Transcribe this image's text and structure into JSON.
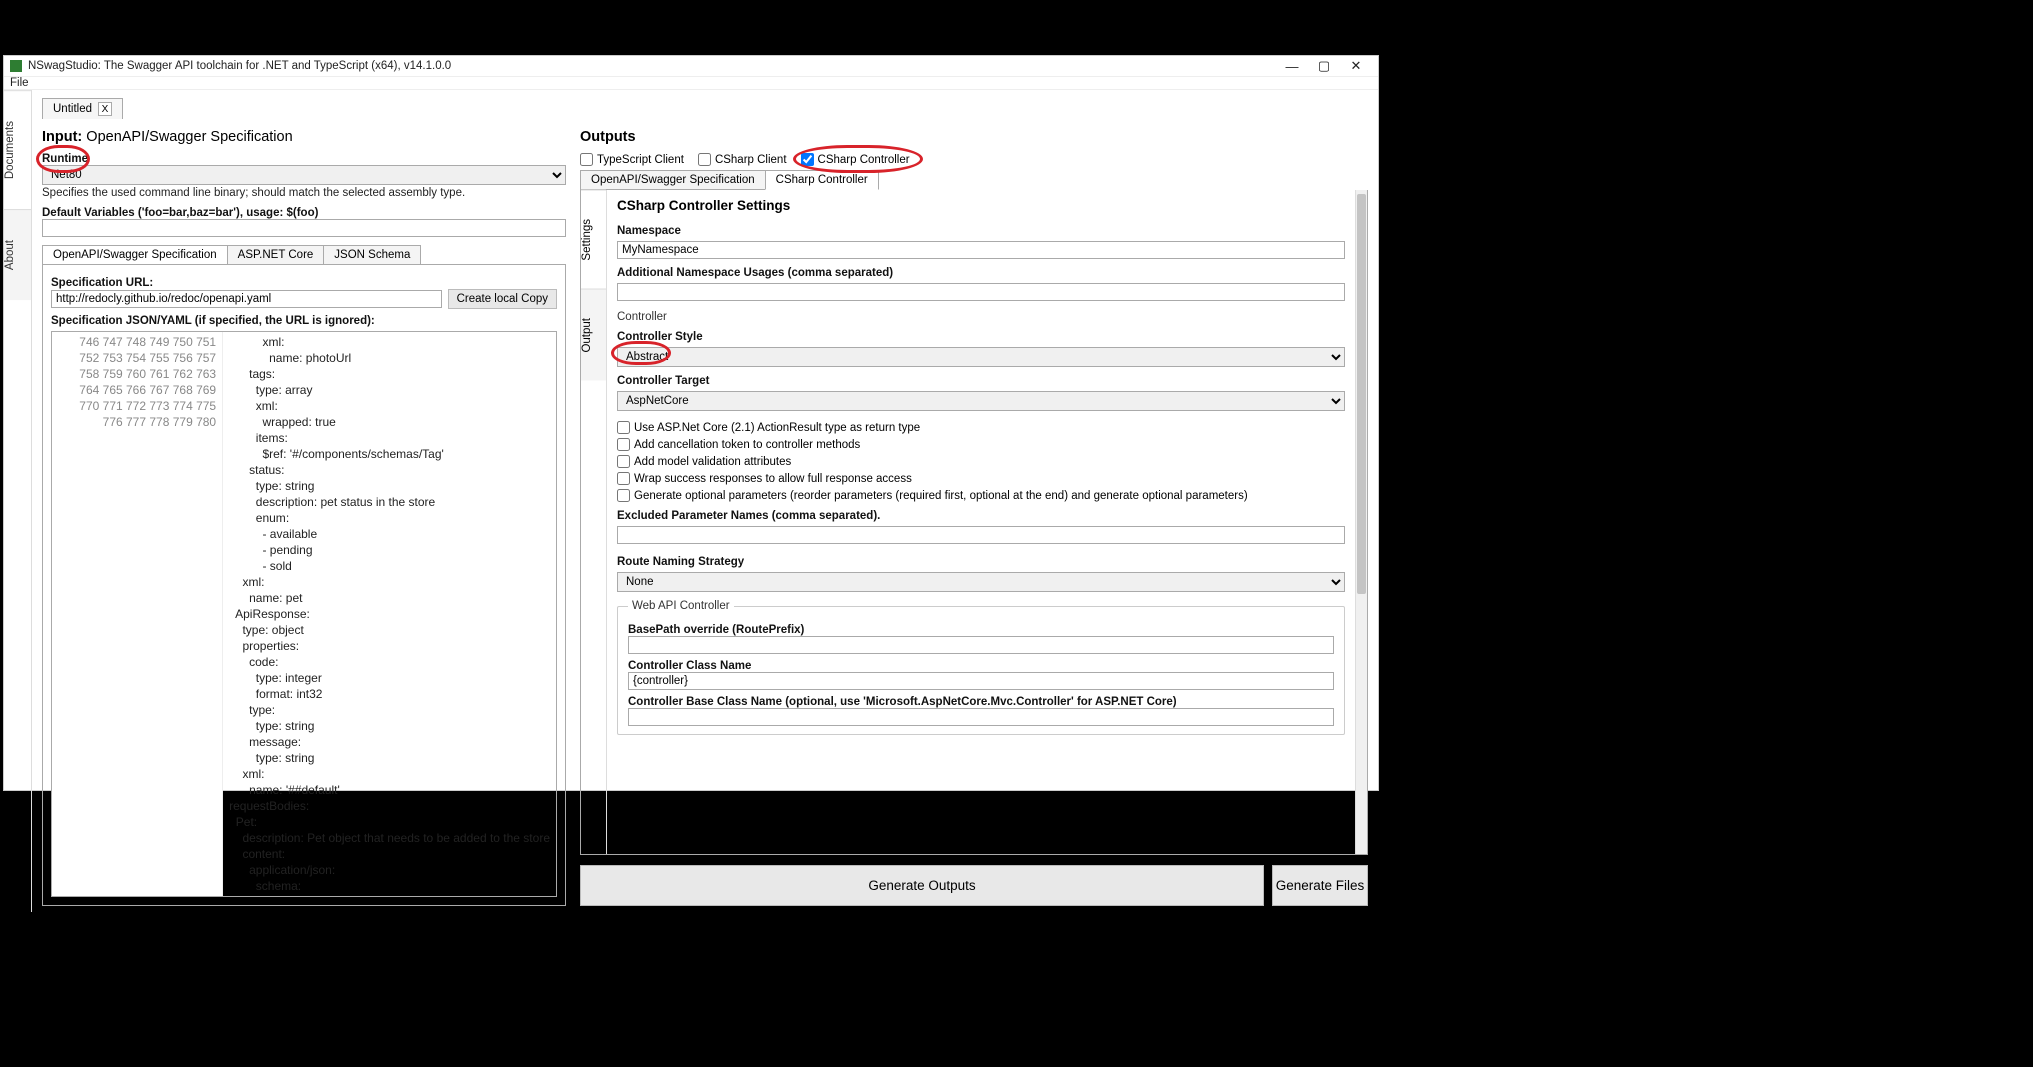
{
  "window": {
    "title": "NSwagStudio: The Swagger API toolchain for .NET and TypeScript (x64), v14.1.0.0",
    "menu_file": "File"
  },
  "sidetabs": {
    "documents": "Documents",
    "about": "About"
  },
  "doctab": {
    "name": "Untitled",
    "close": "X"
  },
  "left": {
    "heading_strong": "Input:",
    "heading_rest": " OpenAPI/Swagger Specification",
    "runtime_label": "Runtime",
    "runtime_value": "Net80",
    "runtime_hint": "Specifies the used command line binary; should match the selected assembly type.",
    "defvars_label": "Default Variables ('foo=bar,baz=bar'), usage: $(foo)",
    "defvars_value": "",
    "tabs": {
      "spec": "OpenAPI/Swagger Specification",
      "aspnet": "ASP.NET Core",
      "json": "JSON Schema"
    },
    "spec_url_label": "Specification URL:",
    "spec_url_value": "http://redocly.github.io/redoc/openapi.yaml",
    "create_copy": "Create local Copy",
    "spec_yaml_label": "Specification JSON/YAML (if specified, the URL is ignored):"
  },
  "code": {
    "start": 746,
    "lines": [
      "          xml:",
      "            name: photoUrl",
      "      tags:",
      "        type: array",
      "        xml:",
      "          wrapped: <kw>true</kw>",
      "        items:",
      "          $ref: <str>'#/components/schemas/Tag'</str>",
      "      status:",
      "        type: string",
      "        description: pet status <kw>in</kw> the store",
      "        <kw>enum</kw>:",
      "          - available",
      "          - pending",
      "          - sold",
      "    xml:",
      "      name: pet",
      "  ApiResponse:",
      "    type: object",
      "    properties:",
      "      code:",
      "        type: integer",
      "        format: int32",
      "      type:",
      "        type: string",
      "      message:",
      "        type: string",
      "    xml:",
      "      name: <str>'##default'</str>",
      "requestBodies:",
      "  Pet:",
      "    description: Pet object that needs to be added to the store",
      "    content:",
      "      application/<kw>json</kw>:",
      "        schema:"
    ]
  },
  "right": {
    "heading": "Outputs",
    "chk_ts": "TypeScript Client",
    "chk_csclient": "CSharp Client",
    "chk_csctrl": "CSharp Controller",
    "chk_ts_on": false,
    "chk_csclient_on": false,
    "chk_csctrl_on": true,
    "tabs": {
      "spec": "OpenAPI/Swagger Specification",
      "ctrl": "CSharp Controller"
    },
    "vtabs": {
      "settings": "Settings",
      "output": "Output"
    }
  },
  "settings": {
    "title": "CSharp Controller Settings",
    "namespace_label": "Namespace",
    "namespace_value": "MyNamespace",
    "addns_label": "Additional Namespace Usages (comma separated)",
    "addns_value": "",
    "controller_group": "Controller",
    "style_label": "Controller Style",
    "style_value": "Abstract",
    "target_label": "Controller Target",
    "target_value": "AspNetCore",
    "cb1": "Use ASP.Net Core (2.1) ActionResult type as return type",
    "cb2": "Add cancellation token to controller methods",
    "cb3": "Add model validation attributes",
    "cb4": "Wrap success responses to allow full response access",
    "cb5": "Generate optional parameters (reorder parameters (required first, optional at the end) and generate optional parameters)",
    "excluded_label": "Excluded Parameter Names (comma separated).",
    "excluded_value": "",
    "route_label": "Route Naming Strategy",
    "route_value": "None",
    "webapi_group": "Web API Controller",
    "basepath_label": "BasePath override (RoutePrefix)",
    "basepath_value": "",
    "classname_label": "Controller Class Name",
    "classname_value": "{controller}",
    "baseclass_label": "Controller Base Class Name (optional, use 'Microsoft.AspNetCore.Mvc.Controller' for ASP.NET Core)",
    "baseclass_value": ""
  },
  "footer": {
    "gen_outputs": "Generate Outputs",
    "gen_files": "Generate Files"
  }
}
